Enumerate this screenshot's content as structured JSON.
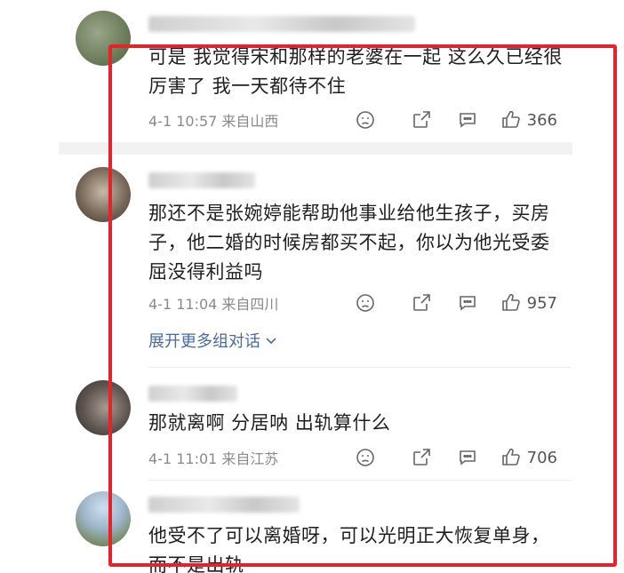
{
  "comments": [
    {
      "text": "可是 我觉得宋和那样的老婆在一起 这么久已经很厉害了 我一天都待不住",
      "time": "4-1 10:57",
      "location": "来自山西",
      "likes": "366"
    },
    {
      "text": "那还不是张婉婷能帮助他事业给他生孩子，买房子，他二婚的时候房都买不起，你以为他光受委屈没得利益吗",
      "time": "4-1 11:04",
      "location": "来自四川",
      "likes": "957",
      "expand": "展开更多组对话"
    },
    {
      "text": "那就离啊 分居呐 出轨算什么",
      "time": "4-1 11:01",
      "location": "来自江苏",
      "likes": "706"
    },
    {
      "text": "他受不了可以离婚呀，可以光明正大恢复单身，而不是出轨"
    }
  ],
  "colors": {
    "highlight_border": "#e8222a",
    "link": "#4a6aa3",
    "meta": "#8a8a8a"
  },
  "icons": [
    "dislike-icon",
    "share-icon",
    "comment-icon",
    "like-icon",
    "chevron-down-icon"
  ]
}
